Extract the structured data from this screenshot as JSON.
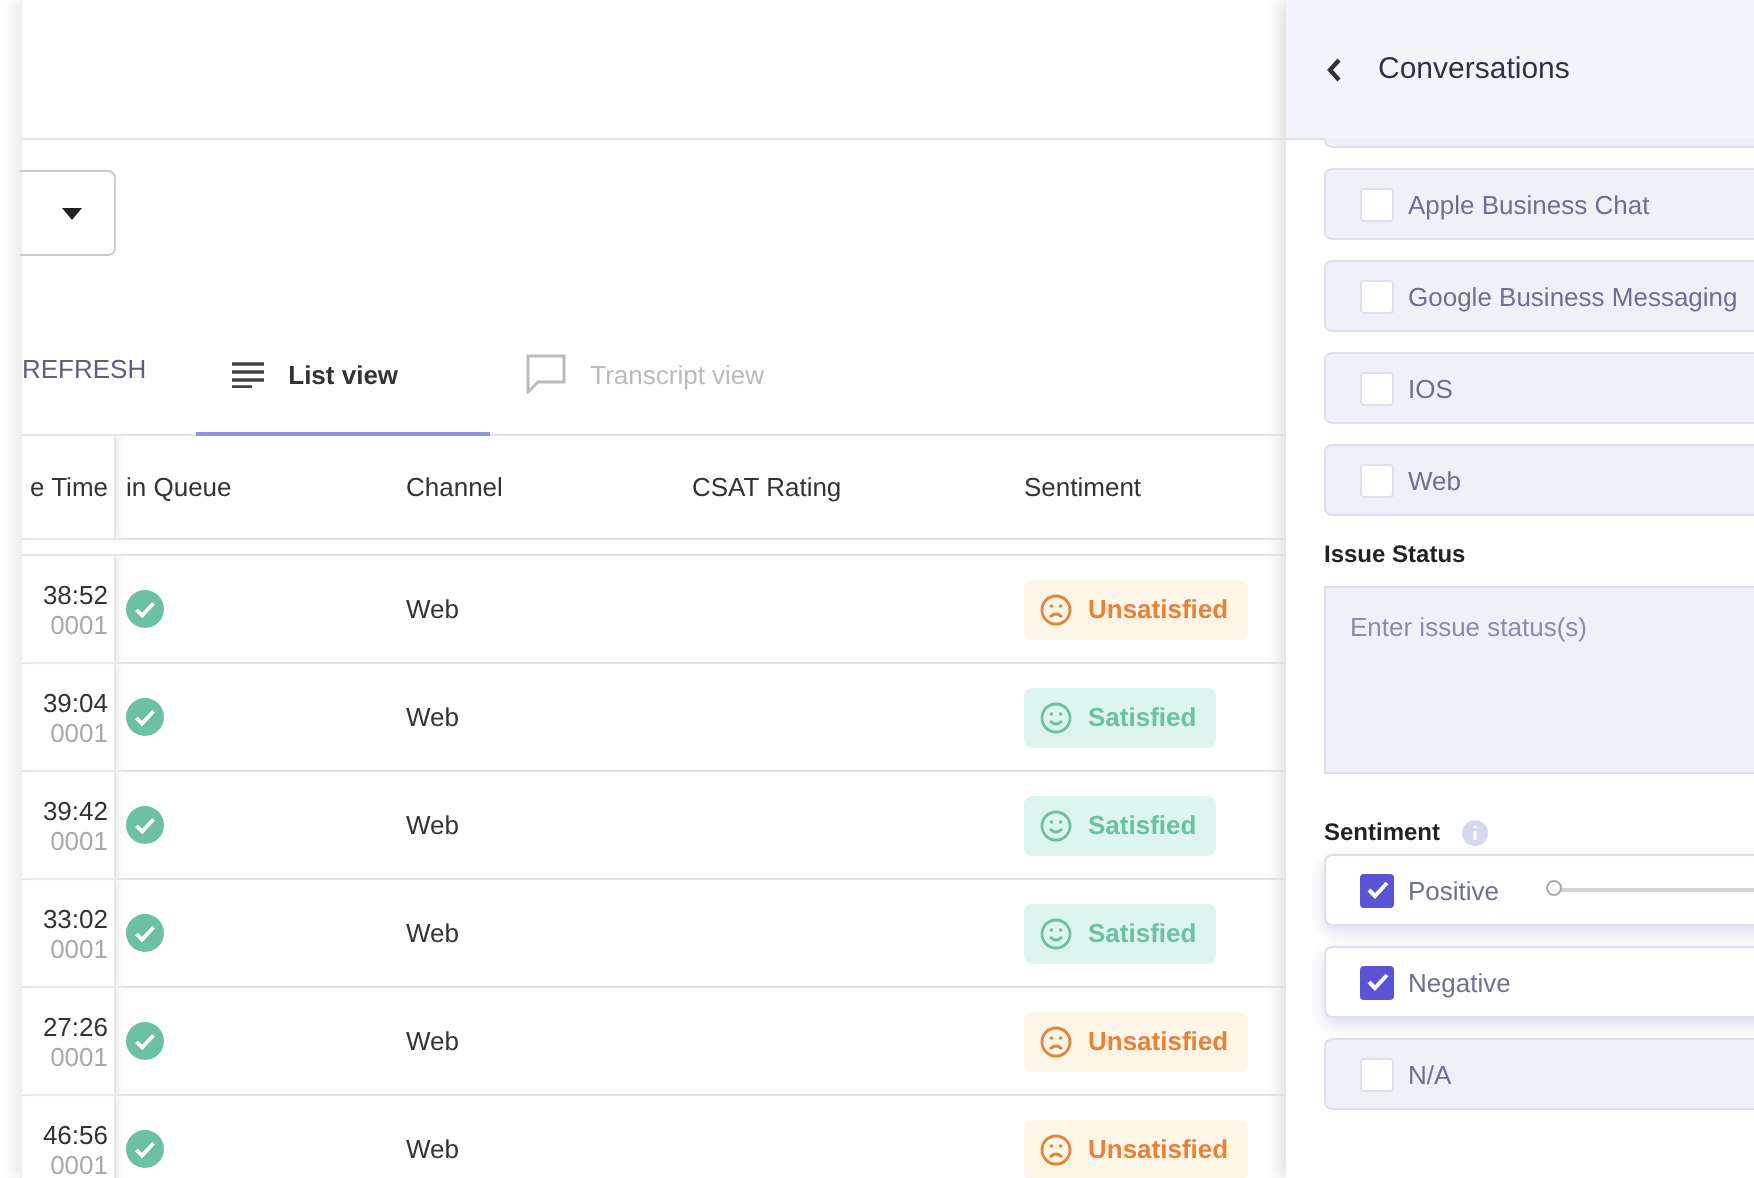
{
  "toolbar": {
    "refresh": "REFRESH",
    "tabs": [
      {
        "label": "List view",
        "selected": true
      },
      {
        "label": "Transcript view",
        "selected": false
      }
    ]
  },
  "table": {
    "columns": [
      "e Time",
      "in Queue",
      "Channel",
      "CSAT Rating",
      "Sentiment"
    ],
    "rows": [
      {
        "time": "38:52",
        "id": "0001",
        "in_queue": true,
        "channel": "Web",
        "sentiment": {
          "kind": "unsatisfied",
          "label": "Unsatisfied"
        }
      },
      {
        "time": "39:04",
        "id": "0001",
        "in_queue": true,
        "channel": "Web",
        "sentiment": {
          "kind": "satisfied",
          "label": "Satisfied"
        }
      },
      {
        "time": "39:42",
        "id": "0001",
        "in_queue": true,
        "channel": "Web",
        "sentiment": {
          "kind": "satisfied",
          "label": "Satisfied"
        }
      },
      {
        "time": "33:02",
        "id": "0001",
        "in_queue": true,
        "channel": "Web",
        "sentiment": {
          "kind": "satisfied",
          "label": "Satisfied"
        }
      },
      {
        "time": "27:26",
        "id": "0001",
        "in_queue": true,
        "channel": "Web",
        "sentiment": {
          "kind": "unsatisfied",
          "label": "Unsatisfied"
        }
      },
      {
        "time": "46:56",
        "id": "0001",
        "in_queue": true,
        "channel": "Web",
        "sentiment": {
          "kind": "unsatisfied",
          "label": "Unsatisfied"
        }
      }
    ]
  },
  "panel": {
    "title": "Conversations",
    "channels": [
      {
        "label": "Apple Business Chat",
        "checked": false
      },
      {
        "label": "Google Business Messaging",
        "checked": false
      },
      {
        "label": "IOS",
        "checked": false
      },
      {
        "label": "Web",
        "checked": false
      }
    ],
    "issue_status": {
      "label": "Issue Status",
      "placeholder": "Enter issue status(s)"
    },
    "sentiment": {
      "label": "Sentiment",
      "options": [
        {
          "label": "Positive",
          "checked": true,
          "kind": "slider",
          "level": 0
        },
        {
          "label": "Negative",
          "checked": true,
          "kind": "plain"
        },
        {
          "label": "N/A",
          "checked": false,
          "kind": "plain"
        }
      ]
    }
  }
}
